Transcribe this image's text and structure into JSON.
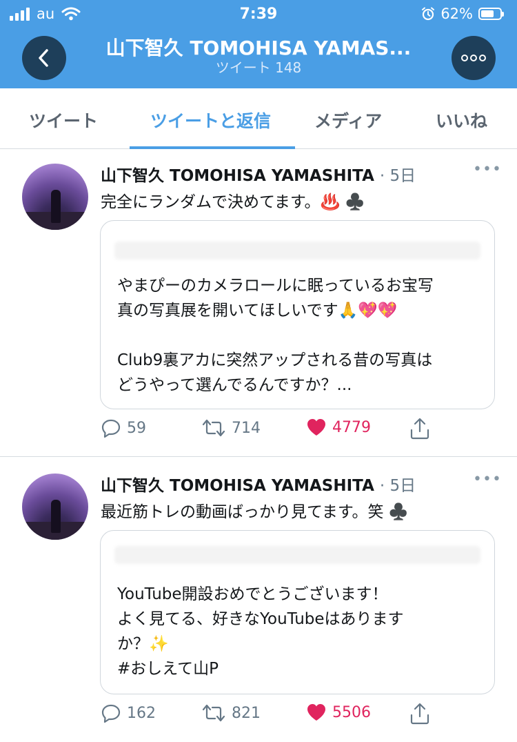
{
  "status_bar": {
    "carrier": "au",
    "time": "7:39",
    "battery": "62%"
  },
  "header": {
    "title": "山下智久 TOMOHISA YAMAS...",
    "subtitle": "ツイート 148"
  },
  "tabs": [
    {
      "label": "ツイート",
      "active": false
    },
    {
      "label": "ツイートと返信",
      "active": true
    },
    {
      "label": "メディア",
      "active": false
    },
    {
      "label": "いいね",
      "active": false
    }
  ],
  "tweets": [
    {
      "author": "山下智久 TOMOHISA YAMASHITA",
      "time": "· 5日",
      "text": "完全にランダムで決めてます。♨️ ♣️",
      "quote": "やまぴーのカメラロールに眠っているお宝写\n真の写真展を開いてほしいです🙏💖💖\n\nClub9裏アカに突然アップされる昔の写真は\nどうやって選んでるんですか？...",
      "replies": "59",
      "retweets": "714",
      "likes": "4779"
    },
    {
      "author": "山下智久 TOMOHISA YAMASHITA",
      "time": "· 5日",
      "text": "最近筋トレの動画ばっかり見てます。笑 ♣️",
      "quote": "YouTube開設おめでとうございます！\nよく見てる、好きなYouTubeはあります\nか？✨\n#おしえて山P",
      "replies": "162",
      "retweets": "821",
      "likes": "5506"
    }
  ],
  "colors": {
    "header": "#4a9ee5",
    "accent": "#4a9ee5",
    "like": "#e0245e"
  },
  "icons": [
    "back-arrow-icon",
    "more-icon",
    "reply-icon",
    "retweet-icon",
    "heart-icon",
    "share-icon",
    "signal-icon",
    "wifi-icon",
    "alarm-icon",
    "battery-icon"
  ]
}
